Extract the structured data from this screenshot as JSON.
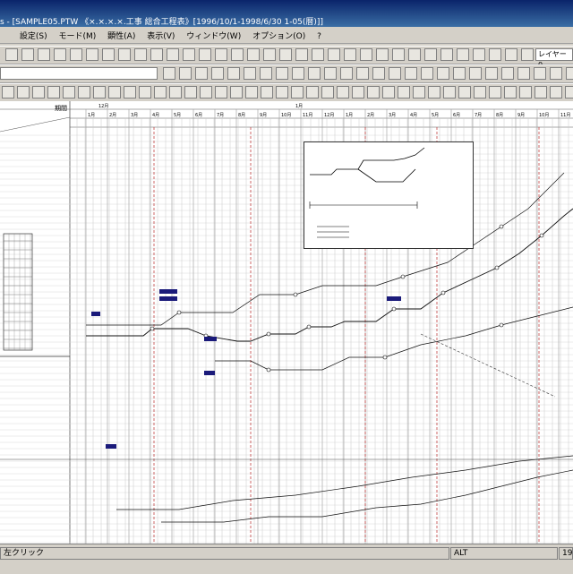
{
  "window": {
    "title": "s - [SAMPLE05.PTW 《×.×.×.×.工事 総合工程表》[1996/10/1-1998/6/30 1-05(暦)]]"
  },
  "menu": [
    {
      "id": "settings",
      "label": "設定(S)"
    },
    {
      "id": "mode",
      "label": "モード(M)"
    },
    {
      "id": "arrange",
      "label": "顕性(A)"
    },
    {
      "id": "view",
      "label": "表示(V)"
    },
    {
      "id": "window",
      "label": "ウィンドウ(W)"
    },
    {
      "id": "options",
      "label": "オプション(O)"
    },
    {
      "id": "help",
      "label": "?"
    }
  ],
  "toolbar": {
    "layer_label": "レイヤー 0"
  },
  "timeline": {
    "header_label": "期間",
    "months_top": [
      "12月",
      "1月"
    ],
    "month_labels": [
      "1月",
      "2月",
      "3月",
      "4月",
      "5月",
      "6月",
      "7月",
      "8月",
      "9月",
      "10月",
      "11月",
      "12月",
      "1月",
      "2月",
      "3月",
      "4月",
      "5月",
      "6月",
      "7月",
      "8月",
      "9月",
      "10月",
      "11月"
    ]
  },
  "status": {
    "left": "左クリック",
    "mode": "ALT",
    "right": "199"
  },
  "colors": {
    "title_bar": "#0a246a",
    "canvas": "#ffffff",
    "grid": "#c8c8c8",
    "red_line": "#c04040",
    "box": "#1a1a7a"
  }
}
